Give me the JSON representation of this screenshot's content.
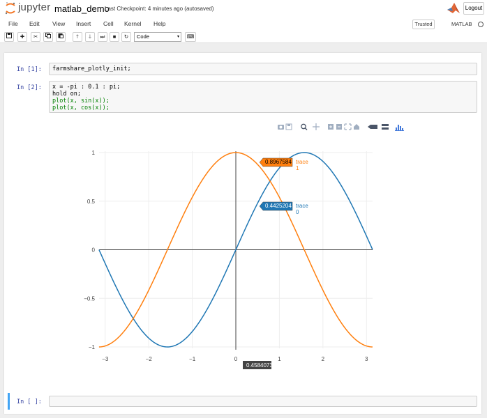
{
  "header": {
    "logo_text": "jupyter",
    "notebook_title": "matlab_demo",
    "checkpoint": "Last Checkpoint: 4 minutes ago (autosaved)",
    "logout_label": "Logout"
  },
  "menubar": {
    "items": [
      "File",
      "Edit",
      "View",
      "Insert",
      "Cell",
      "Kernel",
      "Help"
    ],
    "trusted_label": "Trusted",
    "kernel_name": "MATLAB"
  },
  "toolbar": {
    "cell_type": "Code",
    "buttons": [
      "save-icon",
      "plus-icon",
      "cut-icon",
      "copy-icon",
      "paste-icon",
      "arrow-up-icon",
      "arrow-down-icon",
      "step-forward-icon",
      "stop-icon",
      "refresh-icon",
      "keyboard-icon"
    ]
  },
  "cells": [
    {
      "prompt": "In [1]:",
      "code": "farmshare_plotly_init;"
    },
    {
      "prompt": "In [2]:",
      "code_lines": [
        "x = -pi : 0.1 : pi;",
        "hold on;",
        "plot(x, sin(x));",
        "plot(x, cos(x));"
      ]
    },
    {
      "prompt": "In [ ]:",
      "code": ""
    }
  ],
  "plot_toolbar_icons": [
    "camera-icon",
    "save-icon",
    "zoom-icon",
    "pan-icon",
    "zoom-in-icon",
    "zoom-out-icon",
    "autoscale-icon",
    "home-icon",
    "hover-closest-icon",
    "hover-compare-icon",
    "plotly-logo-icon"
  ],
  "chart_data": {
    "type": "line",
    "xlim": [
      -3.14,
      3.14
    ],
    "ylim": [
      -1,
      1
    ],
    "xticks": [
      -3,
      -2,
      -1,
      0,
      1,
      2,
      3
    ],
    "yticks": [
      -1,
      -0.5,
      0,
      0.5,
      1
    ],
    "xtick_labels": [
      "−3",
      "−2",
      "−1",
      "0",
      "1",
      "2",
      "3"
    ],
    "ytick_labels": [
      "−1",
      "−0.5",
      "0",
      "0.5",
      "1"
    ],
    "grid": true,
    "series": [
      {
        "name": "trace 0",
        "color": "#1f77b4",
        "function": "sin",
        "x_start": -3.1416,
        "x_step": 0.1,
        "x_end": 3.1416
      },
      {
        "name": "trace 1",
        "color": "#ff7f0e",
        "function": "cos",
        "x_start": -3.1416,
        "x_step": 0.1,
        "x_end": 3.1416
      }
    ],
    "hover": {
      "x_label": "0.4584073",
      "labels": [
        {
          "trace": "trace 1",
          "value": "0.8967584",
          "color": "#ff7f0e"
        },
        {
          "trace": "trace 0",
          "value": "0.4425204",
          "color": "#1f77b4"
        }
      ]
    }
  }
}
